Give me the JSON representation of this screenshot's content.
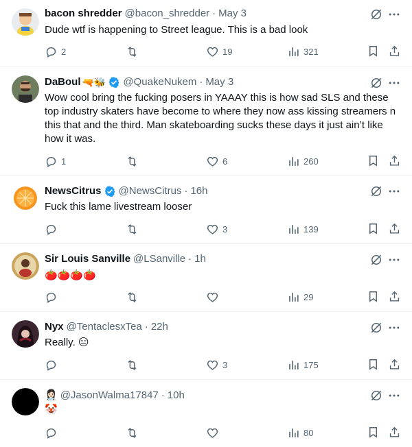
{
  "tweets": [
    {
      "name": "bacon shredder",
      "handle": "@bacon_shredder",
      "time": "May 3",
      "verified": false,
      "decor": "",
      "text": "Dude wtf is happening to Street league. This is a bad look",
      "replies": "2",
      "reposts": "",
      "likes": "19",
      "views": "321"
    },
    {
      "name": "DaBoul",
      "handle": "@QuakeNukem",
      "time": "May 3",
      "verified": true,
      "decor": "🔫🐝",
      "text": "Wow cool bring the fucking posers in YAAAY this is how sad SLS and these top industry skaters have become to where they now ass kissing streamers n this that and the third. Man skateboarding sucks these days it just ain’t like how it was.",
      "replies": "1",
      "reposts": "",
      "likes": "6",
      "views": "260"
    },
    {
      "name": "NewsCitrus",
      "handle": "@NewsCitrus",
      "time": "16h",
      "verified": true,
      "decor": "",
      "text": "Fuck this lame livestream looser",
      "replies": "",
      "reposts": "",
      "likes": "3",
      "views": "139"
    },
    {
      "name": "Sir Louis Sanville",
      "handle": "@LSanville",
      "time": "1h",
      "verified": false,
      "decor": "",
      "text": "🍅🍅🍅🍅",
      "replies": "",
      "reposts": "",
      "likes": "",
      "views": "29"
    },
    {
      "name": "Nyx",
      "handle": "@TentaclesxTea",
      "time": "22h",
      "verified": false,
      "decor": "",
      "text": "Really. 😑",
      "replies": "",
      "reposts": "",
      "likes": "3",
      "views": "175"
    },
    {
      "name": "👩🏻‍⚕️",
      "handle": "@JasonWalma17847",
      "time": "10h",
      "verified": false,
      "decor": "",
      "text": "🤡",
      "replies": "",
      "reposts": "",
      "likes": "",
      "views": "80"
    }
  ],
  "colors": {
    "text": "#0f1419",
    "secondary": "#536471",
    "verified": "#1d9bf0",
    "divider": "#eff3f4"
  },
  "icons": [
    "reply-icon",
    "repost-icon",
    "like-icon",
    "views-icon",
    "bookmark-icon",
    "share-icon",
    "grok-icon",
    "more-icon",
    "verified-icon"
  ]
}
